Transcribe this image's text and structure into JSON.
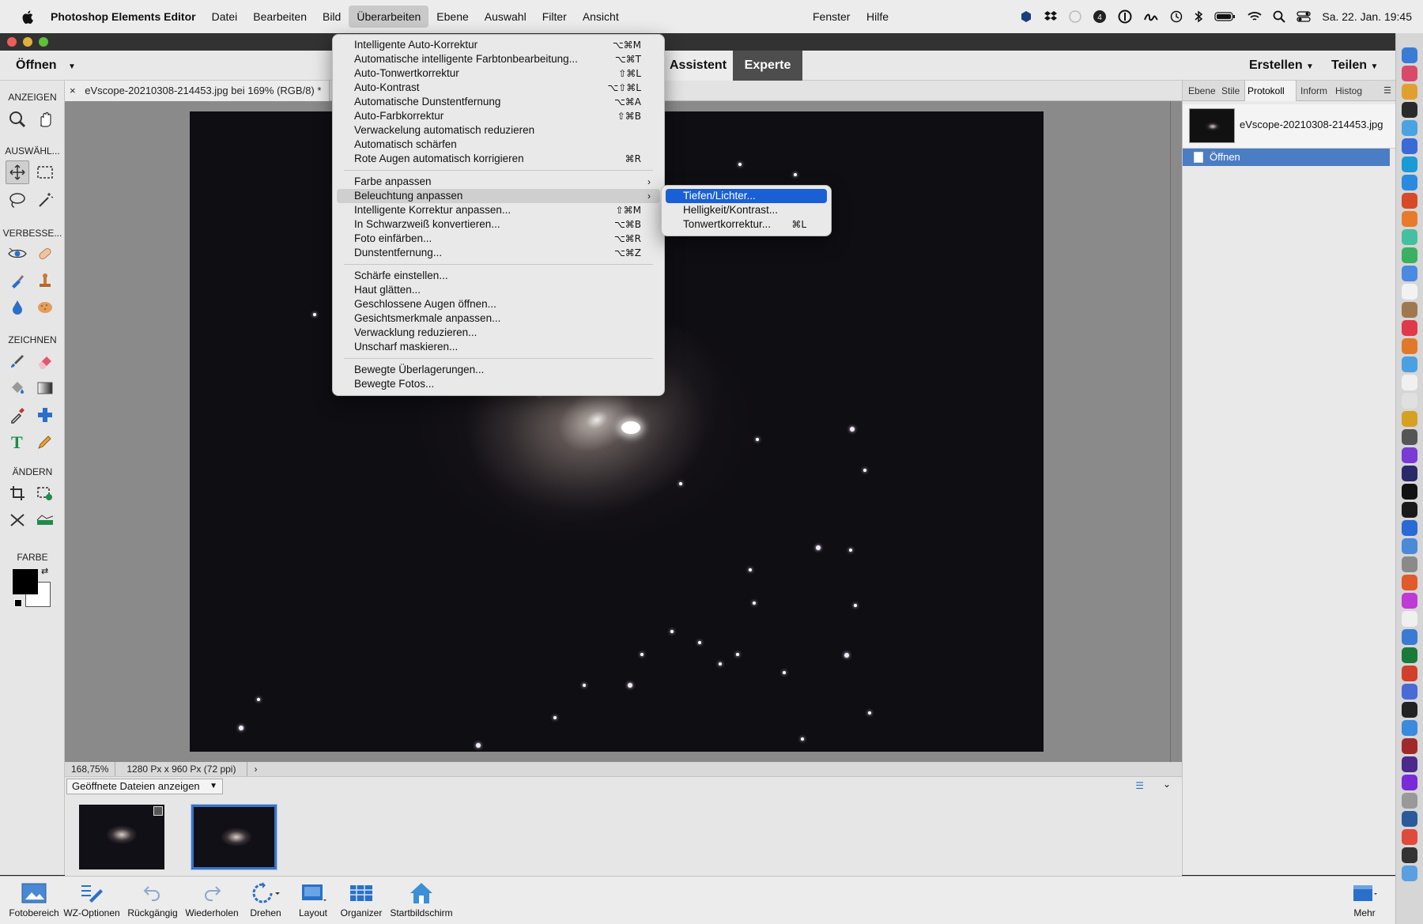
{
  "menubar": {
    "app_name": "Photoshop Elements Editor",
    "items": [
      "Datei",
      "Bearbeiten",
      "Bild",
      "Überarbeiten",
      "Ebene",
      "Auswahl",
      "Filter",
      "Ansicht"
    ],
    "right_items": [
      "Fenster",
      "Hilfe"
    ],
    "clock": "Sa. 22. Jan.  19:45"
  },
  "toolbar": {
    "open_label": "Öffnen",
    "mode_assistant": "Assistent",
    "mode_expert": "Experte",
    "create_label": "Erstellen",
    "share_label": "Teilen"
  },
  "doc_tab": {
    "close": "×",
    "title": "eVscope-20210308-214453.jpg bei 169% (RGB/8) *"
  },
  "tools": {
    "sections": [
      "ANZEIGEN",
      "AUSWÄHL...",
      "VERBESSE...",
      "ZEICHNEN",
      "ÄNDERN",
      "FARBE"
    ]
  },
  "status": {
    "zoom": "168,75%",
    "dimensions": "1280 Px x 960 Px (72 ppi)",
    "arrow": "›"
  },
  "bin": {
    "select_label": "Geöffnete Dateien anzeigen"
  },
  "panel": {
    "tabs": [
      "Ebene",
      "Stile",
      "Protokoll",
      "Inform",
      "Histog"
    ],
    "active_tab": "Protokoll",
    "history_file": "eVscope-20210308-214453.jpg",
    "history_state": "Öffnen"
  },
  "bottombar": {
    "items": [
      "Fotobereich",
      "WZ-Optionen",
      "Rückgängig",
      "Wiederholen",
      "Drehen",
      "Layout",
      "Organizer",
      "Startbildschirm"
    ],
    "more": "Mehr"
  },
  "menu": {
    "items": [
      {
        "label": "Intelligente Auto-Korrektur",
        "shortcut": "⌥⌘M"
      },
      {
        "label": "Automatische intelligente Farbtonbearbeitung...",
        "shortcut": "⌥⌘T"
      },
      {
        "label": "Auto-Tonwertkorrektur",
        "shortcut": "⇧⌘L"
      },
      {
        "label": "Auto-Kontrast",
        "shortcut": "⌥⇧⌘L"
      },
      {
        "label": "Automatische Dunstentfernung",
        "shortcut": "⌥⌘A"
      },
      {
        "label": "Auto-Farbkorrektur",
        "shortcut": "⇧⌘B"
      },
      {
        "label": "Verwackelung automatisch reduzieren",
        "shortcut": ""
      },
      {
        "label": "Automatisch schärfen",
        "shortcut": ""
      },
      {
        "label": "Rote Augen automatisch korrigieren",
        "shortcut": "⌘R"
      },
      {
        "label": "Farbe anpassen",
        "shortcut": ""
      },
      {
        "label": "Beleuchtung anpassen",
        "shortcut": ""
      },
      {
        "label": "Intelligente Korrektur anpassen...",
        "shortcut": "⇧⌘M"
      },
      {
        "label": "In Schwarzweiß konvertieren...",
        "shortcut": "⌥⌘B"
      },
      {
        "label": "Foto einfärben...",
        "shortcut": "⌥⌘R"
      },
      {
        "label": "Dunstentfernung...",
        "shortcut": "⌥⌘Z"
      },
      {
        "label": "Schärfe einstellen...",
        "shortcut": ""
      },
      {
        "label": "Haut glätten...",
        "shortcut": ""
      },
      {
        "label": "Geschlossene Augen öffnen...",
        "shortcut": ""
      },
      {
        "label": "Gesichtsmerkmale anpassen...",
        "shortcut": ""
      },
      {
        "label": "Verwacklung reduzieren...",
        "shortcut": ""
      },
      {
        "label": "Unscharf maskieren...",
        "shortcut": ""
      },
      {
        "label": "Bewegte Überlagerungen...",
        "shortcut": ""
      },
      {
        "label": "Bewegte Fotos...",
        "shortcut": ""
      }
    ]
  },
  "submenu": {
    "items": [
      {
        "label": "Tiefen/Lichter...",
        "shortcut": ""
      },
      {
        "label": "Helligkeit/Kontrast...",
        "shortcut": ""
      },
      {
        "label": "Tonwertkorrektur...",
        "shortcut": "⌘L"
      }
    ]
  },
  "colors": {
    "accent": "#1a5fd6",
    "history_highlight": "#4b7dc4",
    "menu_bg": "#e9e9e9"
  }
}
